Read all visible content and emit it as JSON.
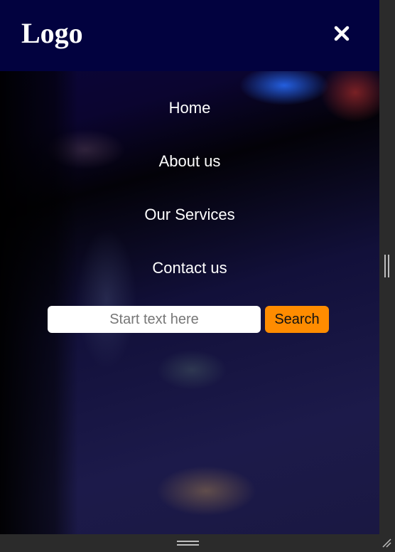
{
  "header": {
    "logo": "Logo",
    "close_icon": "close-icon"
  },
  "nav": {
    "items": [
      {
        "label": "Home"
      },
      {
        "label": "About us"
      },
      {
        "label": "Our Services"
      },
      {
        "label": "Contact us"
      }
    ]
  },
  "search": {
    "placeholder": "Start text here",
    "value": "",
    "button_label": "Search"
  },
  "colors": {
    "header_bg": "#02023f",
    "search_button_bg": "#ff8c00",
    "text": "#ffffff"
  }
}
